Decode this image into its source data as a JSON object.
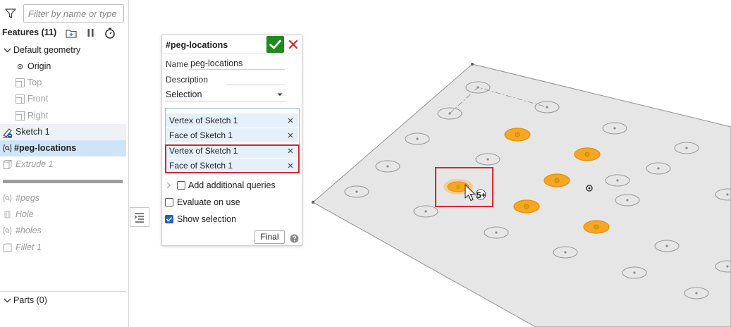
{
  "filter": {
    "placeholder": "Filter by name or type"
  },
  "features": {
    "header": "Features (11)",
    "items": [
      {
        "label": "Default geometry"
      },
      {
        "label": "Origin"
      },
      {
        "label": "Top"
      },
      {
        "label": "Front"
      },
      {
        "label": "Right"
      },
      {
        "label": "Sketch 1"
      },
      {
        "label": "#peg-locations"
      },
      {
        "label": "Extrude 1"
      },
      {
        "label": "#pegs"
      },
      {
        "label": "Hole"
      },
      {
        "label": "#holes"
      },
      {
        "label": "Fillet 1"
      }
    ]
  },
  "parts": {
    "label": "Parts (0)"
  },
  "dialog": {
    "title": "#peg-locations",
    "name_label": "Name",
    "name_value": "peg-locations",
    "description_label": "Description",
    "selection_value": "Selection",
    "queries": [
      {
        "label": "Vertex of Sketch 1"
      },
      {
        "label": "Face of Sketch 1"
      },
      {
        "label": "Vertex of Sketch 1"
      },
      {
        "label": "Face of Sketch 1"
      }
    ],
    "add_queries_label": "Add additional queries",
    "evaluate_label": "Evaluate on use",
    "show_selection_label": "Show selection",
    "final_label": "Final"
  },
  "viewport": {
    "cursor_badge": "5+"
  },
  "colors": {
    "accent_selected_row": "#cfe5f7",
    "ok_green": "#1f8a1f",
    "cancel_red": "#d7262e",
    "highlight_orange": "#f5a623",
    "plane_fill": "#e6e6e6"
  }
}
